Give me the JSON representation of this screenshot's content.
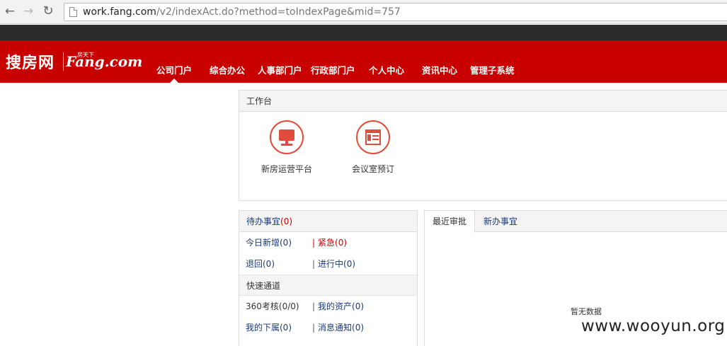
{
  "browser": {
    "url_host": "work.fang.com",
    "url_path": "/v2/indexAct.do?method=toIndexPage&mid=757",
    "back_glyph": "←",
    "forward_glyph": "→",
    "reload_glyph": "↻"
  },
  "header": {
    "logo_cn": "搜房网",
    "logo_en": "Fang.com",
    "logo_small": "房天下",
    "nav": [
      "公司门户",
      "综合办公",
      "人事部门户",
      "行政部门户",
      "个人中心",
      "资讯中心",
      "管理子系统"
    ],
    "active_nav": "公司门户",
    "brand_color": "#c80000"
  },
  "workbench": {
    "title": "工作台",
    "shortcuts": [
      {
        "label": "新房运营平台",
        "icon": "monitor-icon"
      },
      {
        "label": "会议室预订",
        "icon": "calendar-icon"
      }
    ],
    "accent_color": "#e24b3b"
  },
  "todo": {
    "title": "待办事宜",
    "count": "(0)",
    "rows": [
      {
        "left": "今日新增(0)",
        "right": "紧急(0)"
      },
      {
        "left": "退回(0)",
        "right": "进行中(0)"
      }
    ],
    "quick_title": "快速通道",
    "quick_rows": [
      {
        "left": "360考核(0/0)",
        "right": "我的资产(0)"
      },
      {
        "left": "我的下属(0)",
        "right": "消息通知(0)"
      }
    ],
    "separator": "|"
  },
  "tabs": {
    "items": [
      "最近审批",
      "新办事宜"
    ],
    "empty_text": "暂无数据"
  },
  "watermark": "www.wooyun.org"
}
